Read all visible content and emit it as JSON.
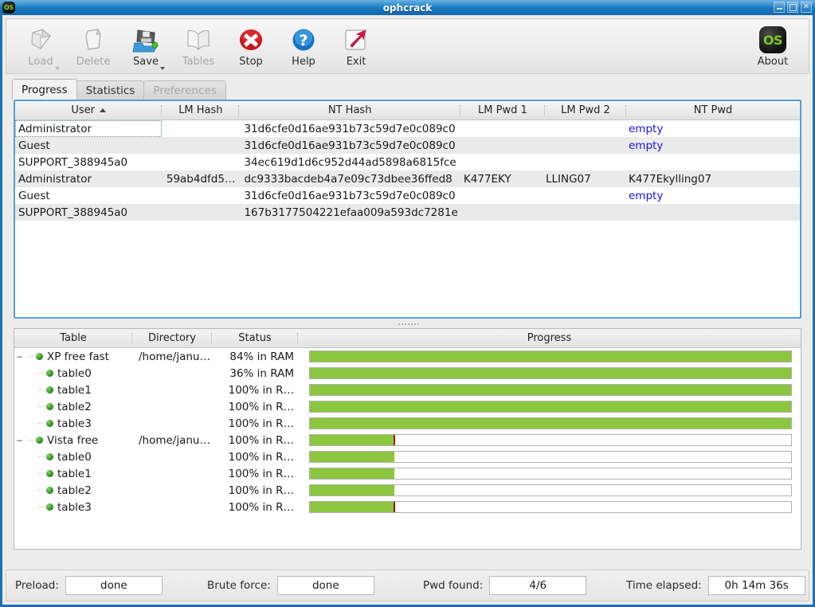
{
  "window": {
    "title": "ophcrack",
    "app_icon": "os-logo-icon",
    "controls": [
      {
        "name": "minimize-button",
        "glyph": "minimize-icon"
      },
      {
        "name": "maximize-button",
        "glyph": "maximize-icon"
      },
      {
        "name": "close-button",
        "glyph": "close-icon"
      }
    ]
  },
  "toolbar": {
    "buttons": [
      {
        "label": "Load",
        "icon": "load-icon",
        "disabled": true,
        "caret": true
      },
      {
        "label": "Delete",
        "icon": "delete-icon",
        "disabled": true,
        "caret": false
      },
      {
        "label": "Save",
        "icon": "save-icon",
        "disabled": false,
        "caret": true
      },
      {
        "label": "Tables",
        "icon": "tables-icon",
        "disabled": true,
        "caret": false
      },
      {
        "label": "Stop",
        "icon": "stop-icon",
        "disabled": false,
        "caret": false
      },
      {
        "label": "Help",
        "icon": "help-icon",
        "disabled": false,
        "caret": false
      },
      {
        "label": "Exit",
        "icon": "exit-icon",
        "disabled": false,
        "caret": false
      }
    ],
    "about": {
      "label": "About",
      "icon": "about-os-icon",
      "badge_text": "OS"
    }
  },
  "tabs": [
    {
      "label": "Progress",
      "active": true,
      "disabled": false
    },
    {
      "label": "Statistics",
      "active": false,
      "disabled": false
    },
    {
      "label": "Preferences",
      "active": false,
      "disabled": true
    }
  ],
  "users_table": {
    "columns": [
      {
        "key": "user",
        "label": "User",
        "sorted": true,
        "sort_dir": "asc"
      },
      {
        "key": "lm",
        "label": "LM Hash",
        "sorted": false
      },
      {
        "key": "nt",
        "label": "NT Hash",
        "sorted": false
      },
      {
        "key": "lmpwd1",
        "label": "LM Pwd 1",
        "sorted": false
      },
      {
        "key": "lmpwd2",
        "label": "LM Pwd 2",
        "sorted": false
      },
      {
        "key": "ntpwd",
        "label": "NT Pwd",
        "sorted": false
      }
    ],
    "rows": [
      {
        "user": "Administrator",
        "lm": "",
        "nt": "31d6cfe0d16ae931b73c59d7e0c089c0",
        "lmpwd1": "",
        "lmpwd2": "",
        "ntpwd": "empty",
        "ntpwd_empty": true,
        "focused": true
      },
      {
        "user": "Guest",
        "lm": "",
        "nt": "31d6cfe0d16ae931b73c59d7e0c089c0",
        "lmpwd1": "",
        "lmpwd2": "",
        "ntpwd": "empty",
        "ntpwd_empty": true,
        "focused": false
      },
      {
        "user": "SUPPORT_388945a0",
        "lm": "",
        "nt": "34ec619d1d6c952d44ad5898a6815fce",
        "lmpwd1": "",
        "lmpwd2": "",
        "ntpwd": "",
        "ntpwd_empty": false,
        "focused": false
      },
      {
        "user": "Administrator",
        "lm": "59ab4dfd5…",
        "nt": "dc9333bacdeb4a7e09c73dbee36ffed8",
        "lmpwd1": "K477EKY",
        "lmpwd2": "LLING07",
        "ntpwd": "K477Ekylling07",
        "ntpwd_empty": false,
        "focused": false
      },
      {
        "user": "Guest",
        "lm": "",
        "nt": "31d6cfe0d16ae931b73c59d7e0c089c0",
        "lmpwd1": "",
        "lmpwd2": "",
        "ntpwd": "empty",
        "ntpwd_empty": true,
        "focused": false
      },
      {
        "user": "SUPPORT_388945a0",
        "lm": "",
        "nt": "167b3177504221efaa009a593dc7281e",
        "lmpwd1": "",
        "lmpwd2": "",
        "ntpwd": "",
        "ntpwd_empty": false,
        "focused": false
      }
    ]
  },
  "tables_table": {
    "columns": [
      {
        "key": "table",
        "label": "Table"
      },
      {
        "key": "dir",
        "label": "Directory"
      },
      {
        "key": "status",
        "label": "Status"
      },
      {
        "key": "progress",
        "label": "Progress"
      }
    ],
    "rows": [
      {
        "table": "XP free fast",
        "dir": "/home/janu…",
        "status": "84% in RAM",
        "depth": 0,
        "expanded": true,
        "progress_pct": 100,
        "marker_pct": null
      },
      {
        "table": "table0",
        "dir": "",
        "status": "36% in RAM",
        "depth": 1,
        "expanded": null,
        "progress_pct": 100,
        "marker_pct": null
      },
      {
        "table": "table1",
        "dir": "",
        "status": "100% in R…",
        "depth": 1,
        "expanded": null,
        "progress_pct": 100,
        "marker_pct": null
      },
      {
        "table": "table2",
        "dir": "",
        "status": "100% in R…",
        "depth": 1,
        "expanded": null,
        "progress_pct": 100,
        "marker_pct": null
      },
      {
        "table": "table3",
        "dir": "",
        "status": "100% in R…",
        "depth": 1,
        "expanded": null,
        "progress_pct": 100,
        "marker_pct": null
      },
      {
        "table": "Vista free",
        "dir": "/home/janu…",
        "status": "100% in R…",
        "depth": 0,
        "expanded": true,
        "progress_pct": 17.6,
        "marker_pct": 17.6
      },
      {
        "table": "table0",
        "dir": "",
        "status": "100% in R…",
        "depth": 1,
        "expanded": null,
        "progress_pct": 17.6,
        "marker_pct": null
      },
      {
        "table": "table1",
        "dir": "",
        "status": "100% in R…",
        "depth": 1,
        "expanded": null,
        "progress_pct": 17.6,
        "marker_pct": null
      },
      {
        "table": "table2",
        "dir": "",
        "status": "100% in R…",
        "depth": 1,
        "expanded": null,
        "progress_pct": 17.6,
        "marker_pct": null
      },
      {
        "table": "table3",
        "dir": "",
        "status": "100% in R…",
        "depth": 1,
        "expanded": null,
        "progress_pct": 17.6,
        "marker_pct": 17.6
      }
    ]
  },
  "statusbar": {
    "fields": [
      {
        "label": "Preload:",
        "value": "done",
        "name": "preload"
      },
      {
        "label": "Brute force:",
        "value": "done",
        "name": "brute-force"
      },
      {
        "label": "Pwd found:",
        "value": "4/6",
        "name": "pwd-found"
      },
      {
        "label": "Time elapsed:",
        "value": "0h 14m 36s",
        "name": "time-elapsed"
      }
    ]
  },
  "colors": {
    "titlebar": "#1a7cc2",
    "progress_green": "#8cc63f",
    "progress_marker": "#a81414",
    "panel_border": "#5a9fd4",
    "link_blue": "#1414ff",
    "logo_green": "#7ec820"
  }
}
